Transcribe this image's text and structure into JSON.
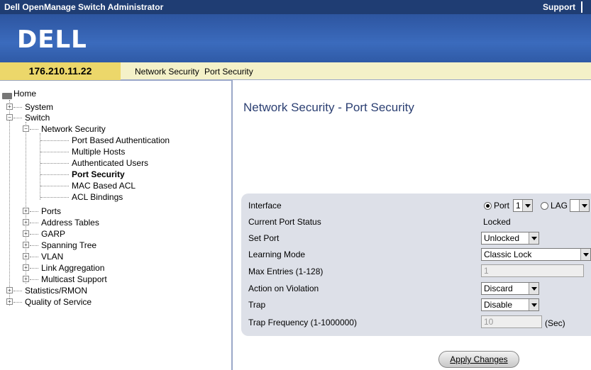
{
  "app": {
    "title": "Dell OpenManage Switch Administrator",
    "support_label": "Support",
    "logo_text": "DELL"
  },
  "header": {
    "ip": "176.210.11.22",
    "breadcrumb": [
      "Network Security",
      "Port Security"
    ]
  },
  "tree": {
    "home": "Home",
    "system": "System",
    "switch": "Switch",
    "network_security": "Network Security",
    "port_based_auth": "Port Based Authentication",
    "multiple_hosts": "Multiple Hosts",
    "authenticated_users": "Authenticated Users",
    "port_security": "Port Security",
    "mac_based_acl": "MAC Based ACL",
    "acl_bindings": "ACL Bindings",
    "ports": "Ports",
    "address_tables": "Address Tables",
    "garp": "GARP",
    "spanning_tree": "Spanning Tree",
    "vlan": "VLAN",
    "link_aggregation": "Link Aggregation",
    "multicast_support": "Multicast Support",
    "statistics_rmon": "Statistics/RMON",
    "quality_of_service": "Quality of Service",
    "expander_plus": "+",
    "expander_minus": "−"
  },
  "page": {
    "title": "Network Security - Port Security"
  },
  "form": {
    "interface_label": "Interface",
    "port_option": "Port",
    "port_value": "1",
    "lag_option": "LAG",
    "lag_value": "",
    "current_status_label": "Current Port Status",
    "current_status_value": "Locked",
    "set_port_label": "Set Port",
    "set_port_value": "Unlocked",
    "learning_mode_label": "Learning Mode",
    "learning_mode_value": "Classic Lock",
    "max_entries_label": "Max Entries (1-128)",
    "max_entries_value": "1",
    "action_label": "Action on Violation",
    "action_value": "Discard",
    "trap_label": "Trap",
    "trap_value": "Disable",
    "trap_freq_label": "Trap Frequency (1-1000000)",
    "trap_freq_value": "10",
    "trap_freq_unit": "(Sec)",
    "apply_label": "Apply Changes"
  }
}
